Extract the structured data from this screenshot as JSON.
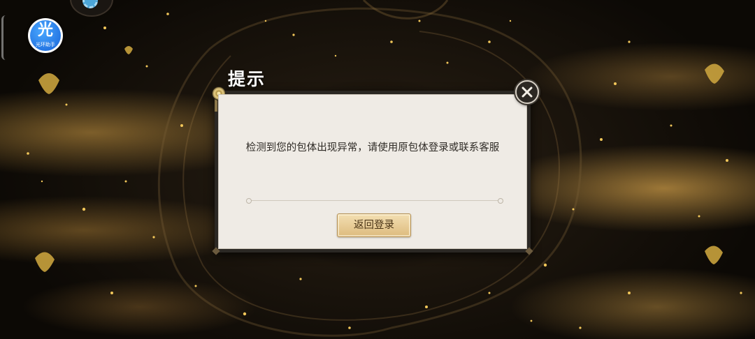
{
  "helper": {
    "glyph": "光",
    "caption": "光环助手",
    "icon": "helper-badge-icon"
  },
  "dialog": {
    "title": "提示",
    "message": "检测到您的包体出现异常，请使用原包体登录或联系客服",
    "button_label": "返回登录",
    "close_icon": "close-icon"
  },
  "colors": {
    "panel_bg": "#efebe5",
    "frame": "#2b2824",
    "button_gold": "#ddbb7e",
    "button_text": "#4a3416",
    "background_glow": "#d4a046"
  }
}
